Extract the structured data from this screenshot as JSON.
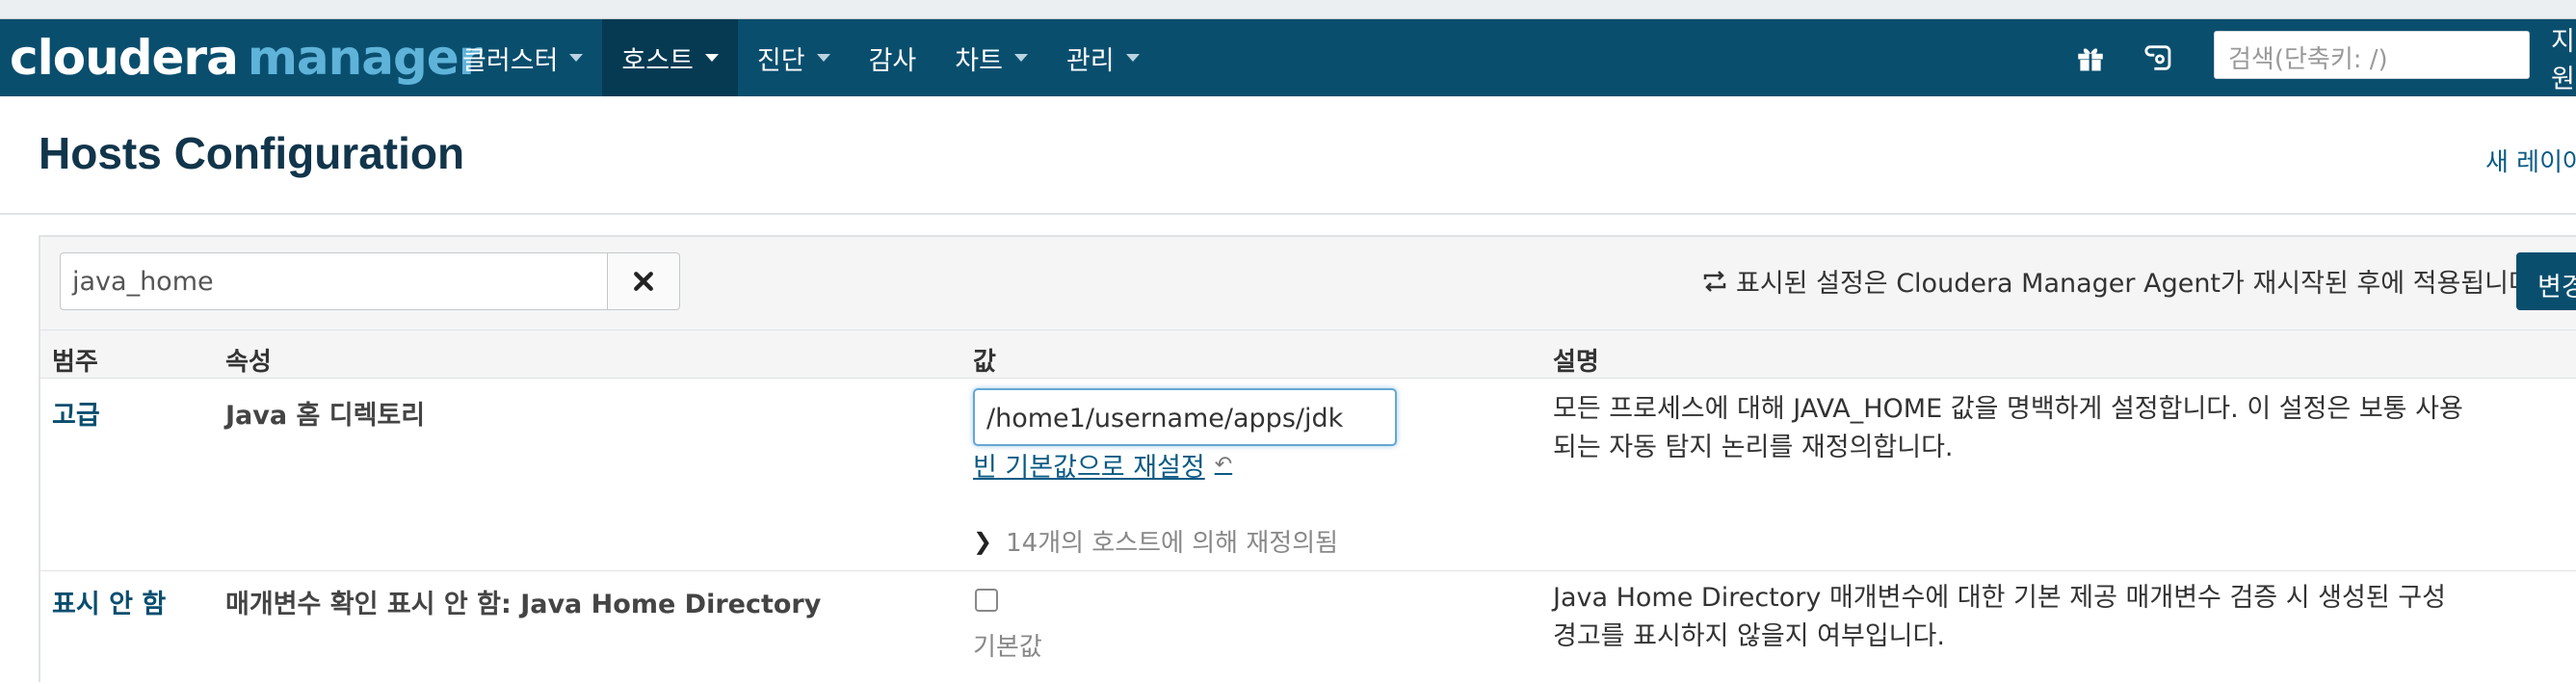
{
  "nav": {
    "logo_part1": "cloudera",
    "logo_part2": "manager",
    "items": [
      {
        "label": "클러스터",
        "dropdown": true
      },
      {
        "label": "호스트",
        "dropdown": true,
        "active": true
      },
      {
        "label": "진단",
        "dropdown": true
      },
      {
        "label": "감사",
        "dropdown": false
      },
      {
        "label": "차트",
        "dropdown": true
      },
      {
        "label": "관리",
        "dropdown": true
      }
    ],
    "search_placeholder": "검색(단축키: /)",
    "extra": "지원",
    "icons": [
      "gift-icon",
      "support-icon"
    ]
  },
  "page": {
    "title": "Hosts Configuration",
    "new_layout_link": "새 레이아웃"
  },
  "filter": {
    "value": "java_home",
    "clear_icon": "close-icon"
  },
  "notice": {
    "text": "표시된 설정은 Cloudera Manager Agent가 재시작된 후에 적용됩니다.",
    "icon": "restart-icon"
  },
  "change_button": "변경 내용 저장",
  "table": {
    "headers": {
      "category": "범주",
      "property": "속성",
      "value": "값",
      "description": "설명"
    },
    "rows": [
      {
        "category": "고급",
        "property": "Java 홈 디렉토리",
        "value": "/home1/username/apps/jdk",
        "reset_label": "빈 기본값으로 재설정",
        "overridden": "14개의 호스트에 의해 재정의됨",
        "description": "모든 프로세스에 대해 JAVA_HOME 값을 명백하게 설정합니다. 이 설정은 보통 사용되는 자동 탐지 논리를 재정의합니다."
      },
      {
        "category": "표시 안 함",
        "property": "매개변수 확인 표시 안 함: Java Home Directory",
        "checked": false,
        "default_label": "기본값",
        "description": "Java Home Directory 매개변수에 대한 기본 제공 매개변수 검증 시 생성된 구성 경고를 표시하지 않을지 여부입니다."
      }
    ]
  }
}
